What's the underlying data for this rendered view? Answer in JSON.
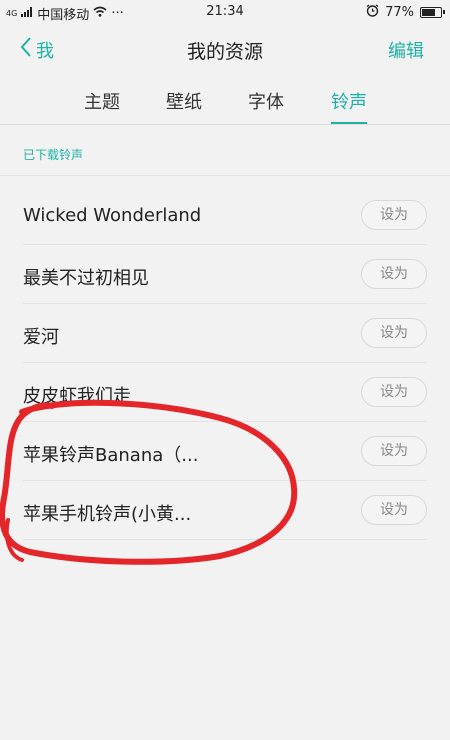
{
  "status_bar": {
    "network_small": "4G",
    "carrier": "中国移动",
    "more": "···",
    "time": "21:34",
    "battery_percent": "77%",
    "battery_level": 0.77
  },
  "nav": {
    "back_label": "我",
    "title": "我的资源",
    "edit_label": "编辑"
  },
  "tabs": [
    {
      "label": "主题"
    },
    {
      "label": "壁纸"
    },
    {
      "label": "字体"
    },
    {
      "label": "铃声"
    }
  ],
  "active_tab": "铃声",
  "section": {
    "label": "已下载铃声"
  },
  "ringtones": [
    {
      "title": "Wicked Wonderland",
      "action": "设为"
    },
    {
      "title": "最美不过初相见",
      "action": "设为"
    },
    {
      "title": "爱河",
      "action": "设为"
    },
    {
      "title": "皮皮虾我们走",
      "action": "设为"
    },
    {
      "title": "苹果铃声Banana（...",
      "action": "设为"
    },
    {
      "title": "苹果手机铃声(小黄...",
      "action": "设为"
    }
  ],
  "colors": {
    "accent": "#1fb1a5",
    "annotation": "#e3262a",
    "background": "#f2f2f2"
  }
}
